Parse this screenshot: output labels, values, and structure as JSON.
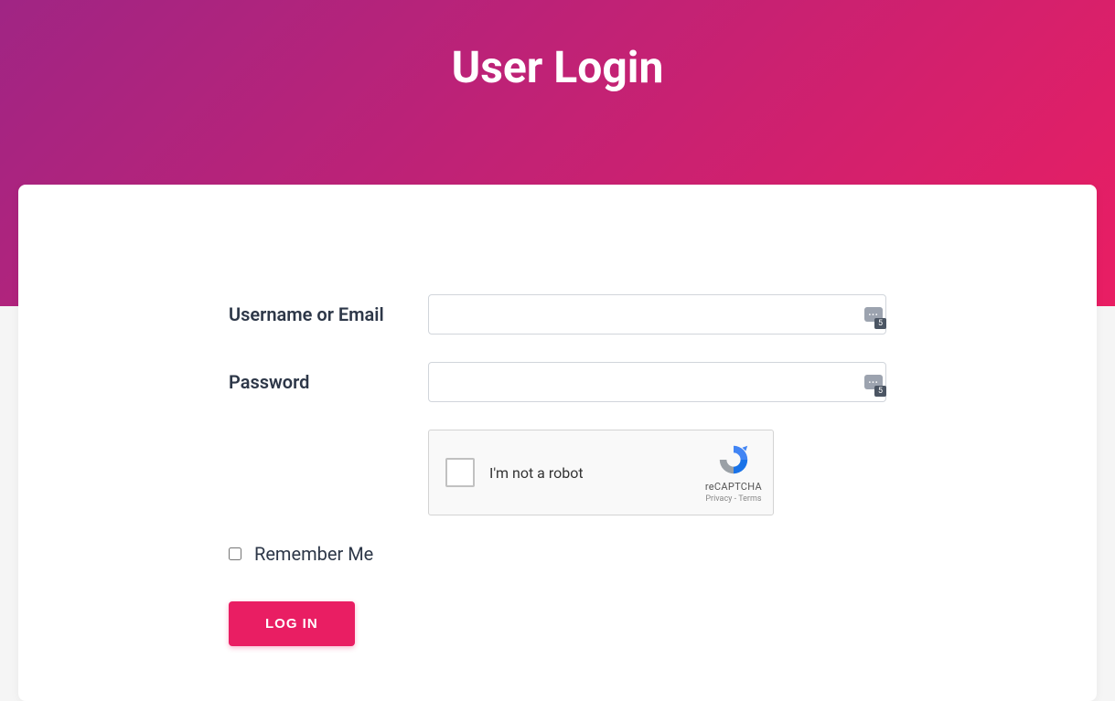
{
  "header": {
    "title": "User Login"
  },
  "form": {
    "username": {
      "label": "Username or Email",
      "value": "",
      "badge_count": "5"
    },
    "password": {
      "label": "Password",
      "value": "",
      "badge_count": "5"
    },
    "recaptcha": {
      "text": "I'm not a robot",
      "brand": "reCAPTCHA",
      "privacy_label": "Privacy",
      "terms_label": "Terms",
      "separator": " - "
    },
    "remember": {
      "label": "Remember Me",
      "checked": false
    },
    "submit": {
      "label": "LOG IN"
    }
  },
  "colors": {
    "accent": "#e91e63",
    "gradient_start": "#a02584",
    "gradient_end": "#e91e63"
  }
}
